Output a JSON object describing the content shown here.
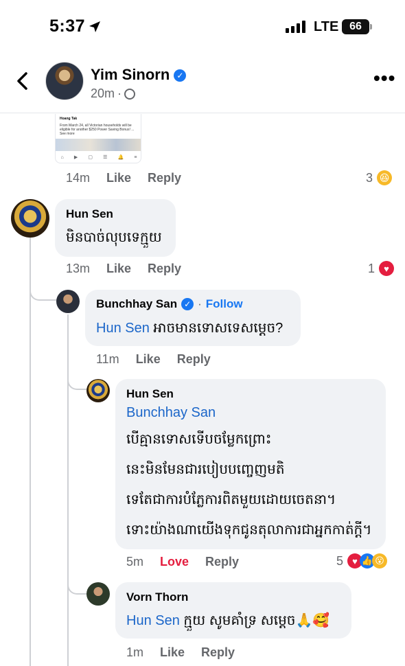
{
  "status_bar": {
    "time": "5:37",
    "network": "LTE",
    "battery": "66"
  },
  "header": {
    "back_icon": "chevron-left-icon",
    "name": "Yim Sinorn",
    "time": "20m",
    "dot": "·",
    "more": "•••"
  },
  "embed": {
    "author": "Hoang Tak",
    "text": "From March 24, all Victorian households will be eligible for another $250 Power Saving Bonus! ... See more"
  },
  "top_comment_meta": {
    "time": "14m",
    "like": "Like",
    "reply": "Reply",
    "reaction_count": "3"
  },
  "comments": [
    {
      "name": "Hun Sen",
      "text": "មិនបាច់លុបទេក្មួយ",
      "time": "13m",
      "like": "Like",
      "reply": "Reply",
      "reaction_count": "1"
    },
    {
      "name": "Bunchhay San",
      "follow": "Follow",
      "dot": "·",
      "mention": "Hun Sen",
      "text": "អាចមានទោសទេសម្តេច?",
      "time": "11m",
      "like": "Like",
      "reply": "Reply"
    },
    {
      "name": "Hun Sen",
      "mention": "Bunchhay San",
      "lines": [
        "បើគ្មានទោសទើបចម្លែកព្រោះ",
        "នេះមិនមែនជារបៀបបញ្ចេញមតិ",
        "ទេតែជាការបំភ្លែការពិតមួយដោយចេតនា។",
        "ទោះយ៉ាងណាយើងទុកជូនតុលាការជាអ្នកកាត់ក្តី។"
      ],
      "time": "5m",
      "like": "Love",
      "reply": "Reply",
      "reaction_count": "5"
    },
    {
      "name": "Vorn Thorn",
      "mention": "Hun Sen",
      "text": "ក្មួយ សូមគាំទ្រ សម្តេច🙏🥰",
      "time": "1m",
      "like": "Like",
      "reply": "Reply"
    }
  ],
  "colors": {
    "link": "#1b66c9",
    "love": "#e41e3f",
    "bubble": "#f0f2f5",
    "verified": "#1877f2"
  }
}
